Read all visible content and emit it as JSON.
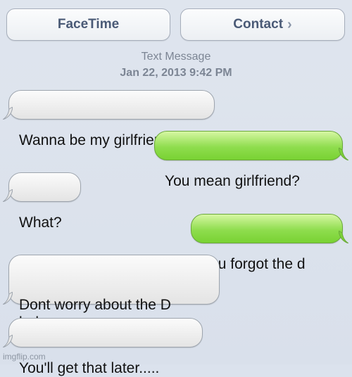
{
  "header": {
    "facetime_label": "FaceTime",
    "contact_label": "Contact",
    "contact_chevron": "›"
  },
  "thread": {
    "type_label": "Text Message",
    "date_label": "Jan 22, 2013 9:42 PM"
  },
  "messages": [
    {
      "side": "left",
      "text": "Wanna be my girlfrien?"
    },
    {
      "side": "right",
      "text": "You mean girlfriend?"
    },
    {
      "side": "left",
      "text": "What?"
    },
    {
      "side": "right",
      "text": "You forgot the d"
    },
    {
      "side": "left",
      "text": "Dont worry about the D\nbaby.."
    },
    {
      "side": "left",
      "text": "You'll get that later....."
    }
  ],
  "watermark": "imgflip.com",
  "colors": {
    "incoming_bubble": "#ececec",
    "outgoing_bubble": "#8fdd4e",
    "background": "#dbe2ed",
    "button_text": "#4a5a76"
  }
}
